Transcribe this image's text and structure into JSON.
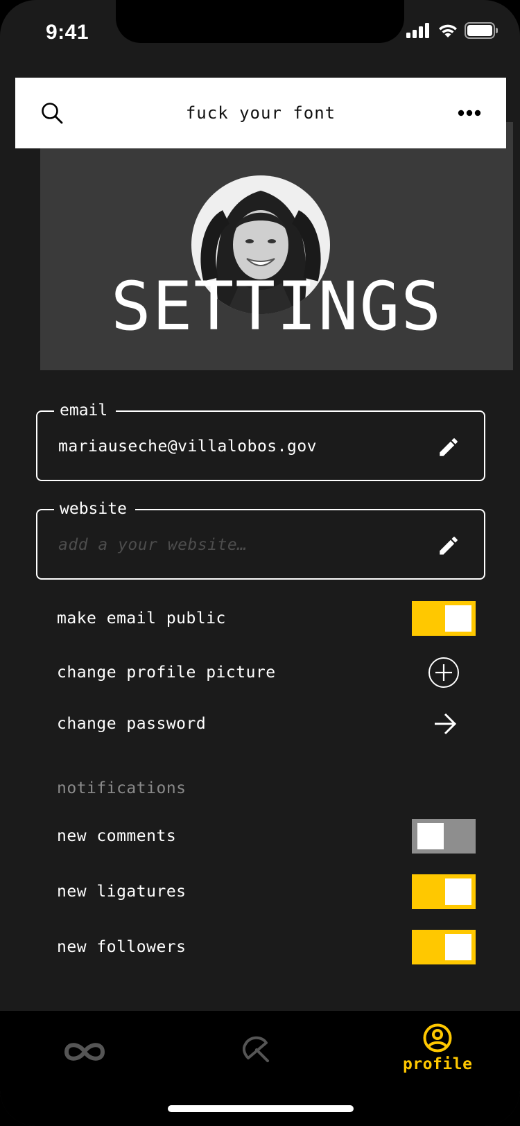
{
  "status_bar": {
    "time": "9:41"
  },
  "header": {
    "title": "fuck your font"
  },
  "hero": {
    "title": "SETTINGS"
  },
  "fields": {
    "email": {
      "label": "email",
      "value": "mariauseche@villalobos.gov"
    },
    "website": {
      "label": "website",
      "value": "",
      "placeholder": "add a your website…"
    }
  },
  "options": {
    "make_email_public": {
      "label": "make email public",
      "enabled": true
    },
    "change_profile_picture": {
      "label": "change profile picture"
    },
    "change_password": {
      "label": "change password"
    }
  },
  "notifications": {
    "section_label": "notifications",
    "items": [
      {
        "label": "new comments",
        "enabled": false
      },
      {
        "label": "new ligatures",
        "enabled": true
      },
      {
        "label": "new followers",
        "enabled": true
      }
    ]
  },
  "bottom_nav": {
    "items": [
      {
        "icon": "infinity-icon",
        "label": ""
      },
      {
        "icon": "umbrella-icon",
        "label": ""
      },
      {
        "icon": "profile-icon",
        "label": "profile",
        "active": true
      }
    ]
  },
  "colors": {
    "accent": "#ffc800",
    "background": "#1b1b1b",
    "hero": "#3a3a3a",
    "muted": "#8a8a8a"
  }
}
